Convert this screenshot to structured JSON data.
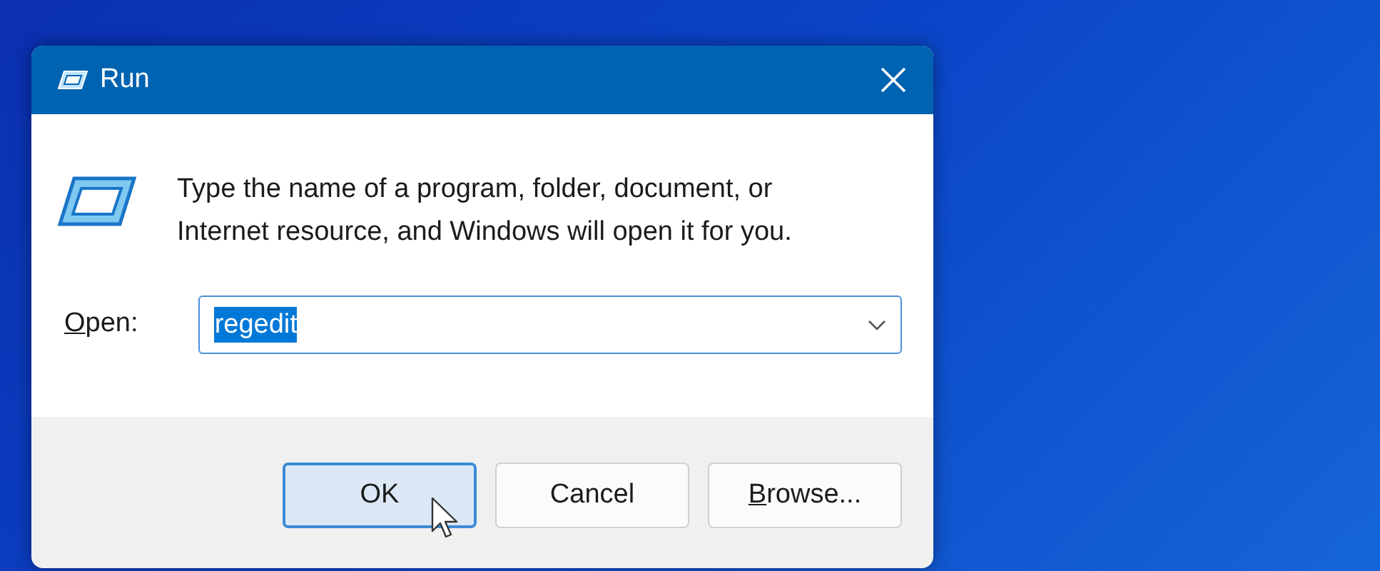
{
  "window": {
    "title": "Run"
  },
  "message": "Type the name of a program, folder, document, or Internet resource, and Windows will open it for you.",
  "open_field": {
    "label": "Open:",
    "label_mnemonic": true,
    "value": "regedit",
    "selected_text": true
  },
  "buttons": [
    {
      "label": "OK",
      "focused": true,
      "mnemonic": false
    },
    {
      "label": "Cancel",
      "focused": false,
      "mnemonic": false
    },
    {
      "label": "Browse...",
      "focused": false,
      "mnemonic": true
    }
  ]
}
